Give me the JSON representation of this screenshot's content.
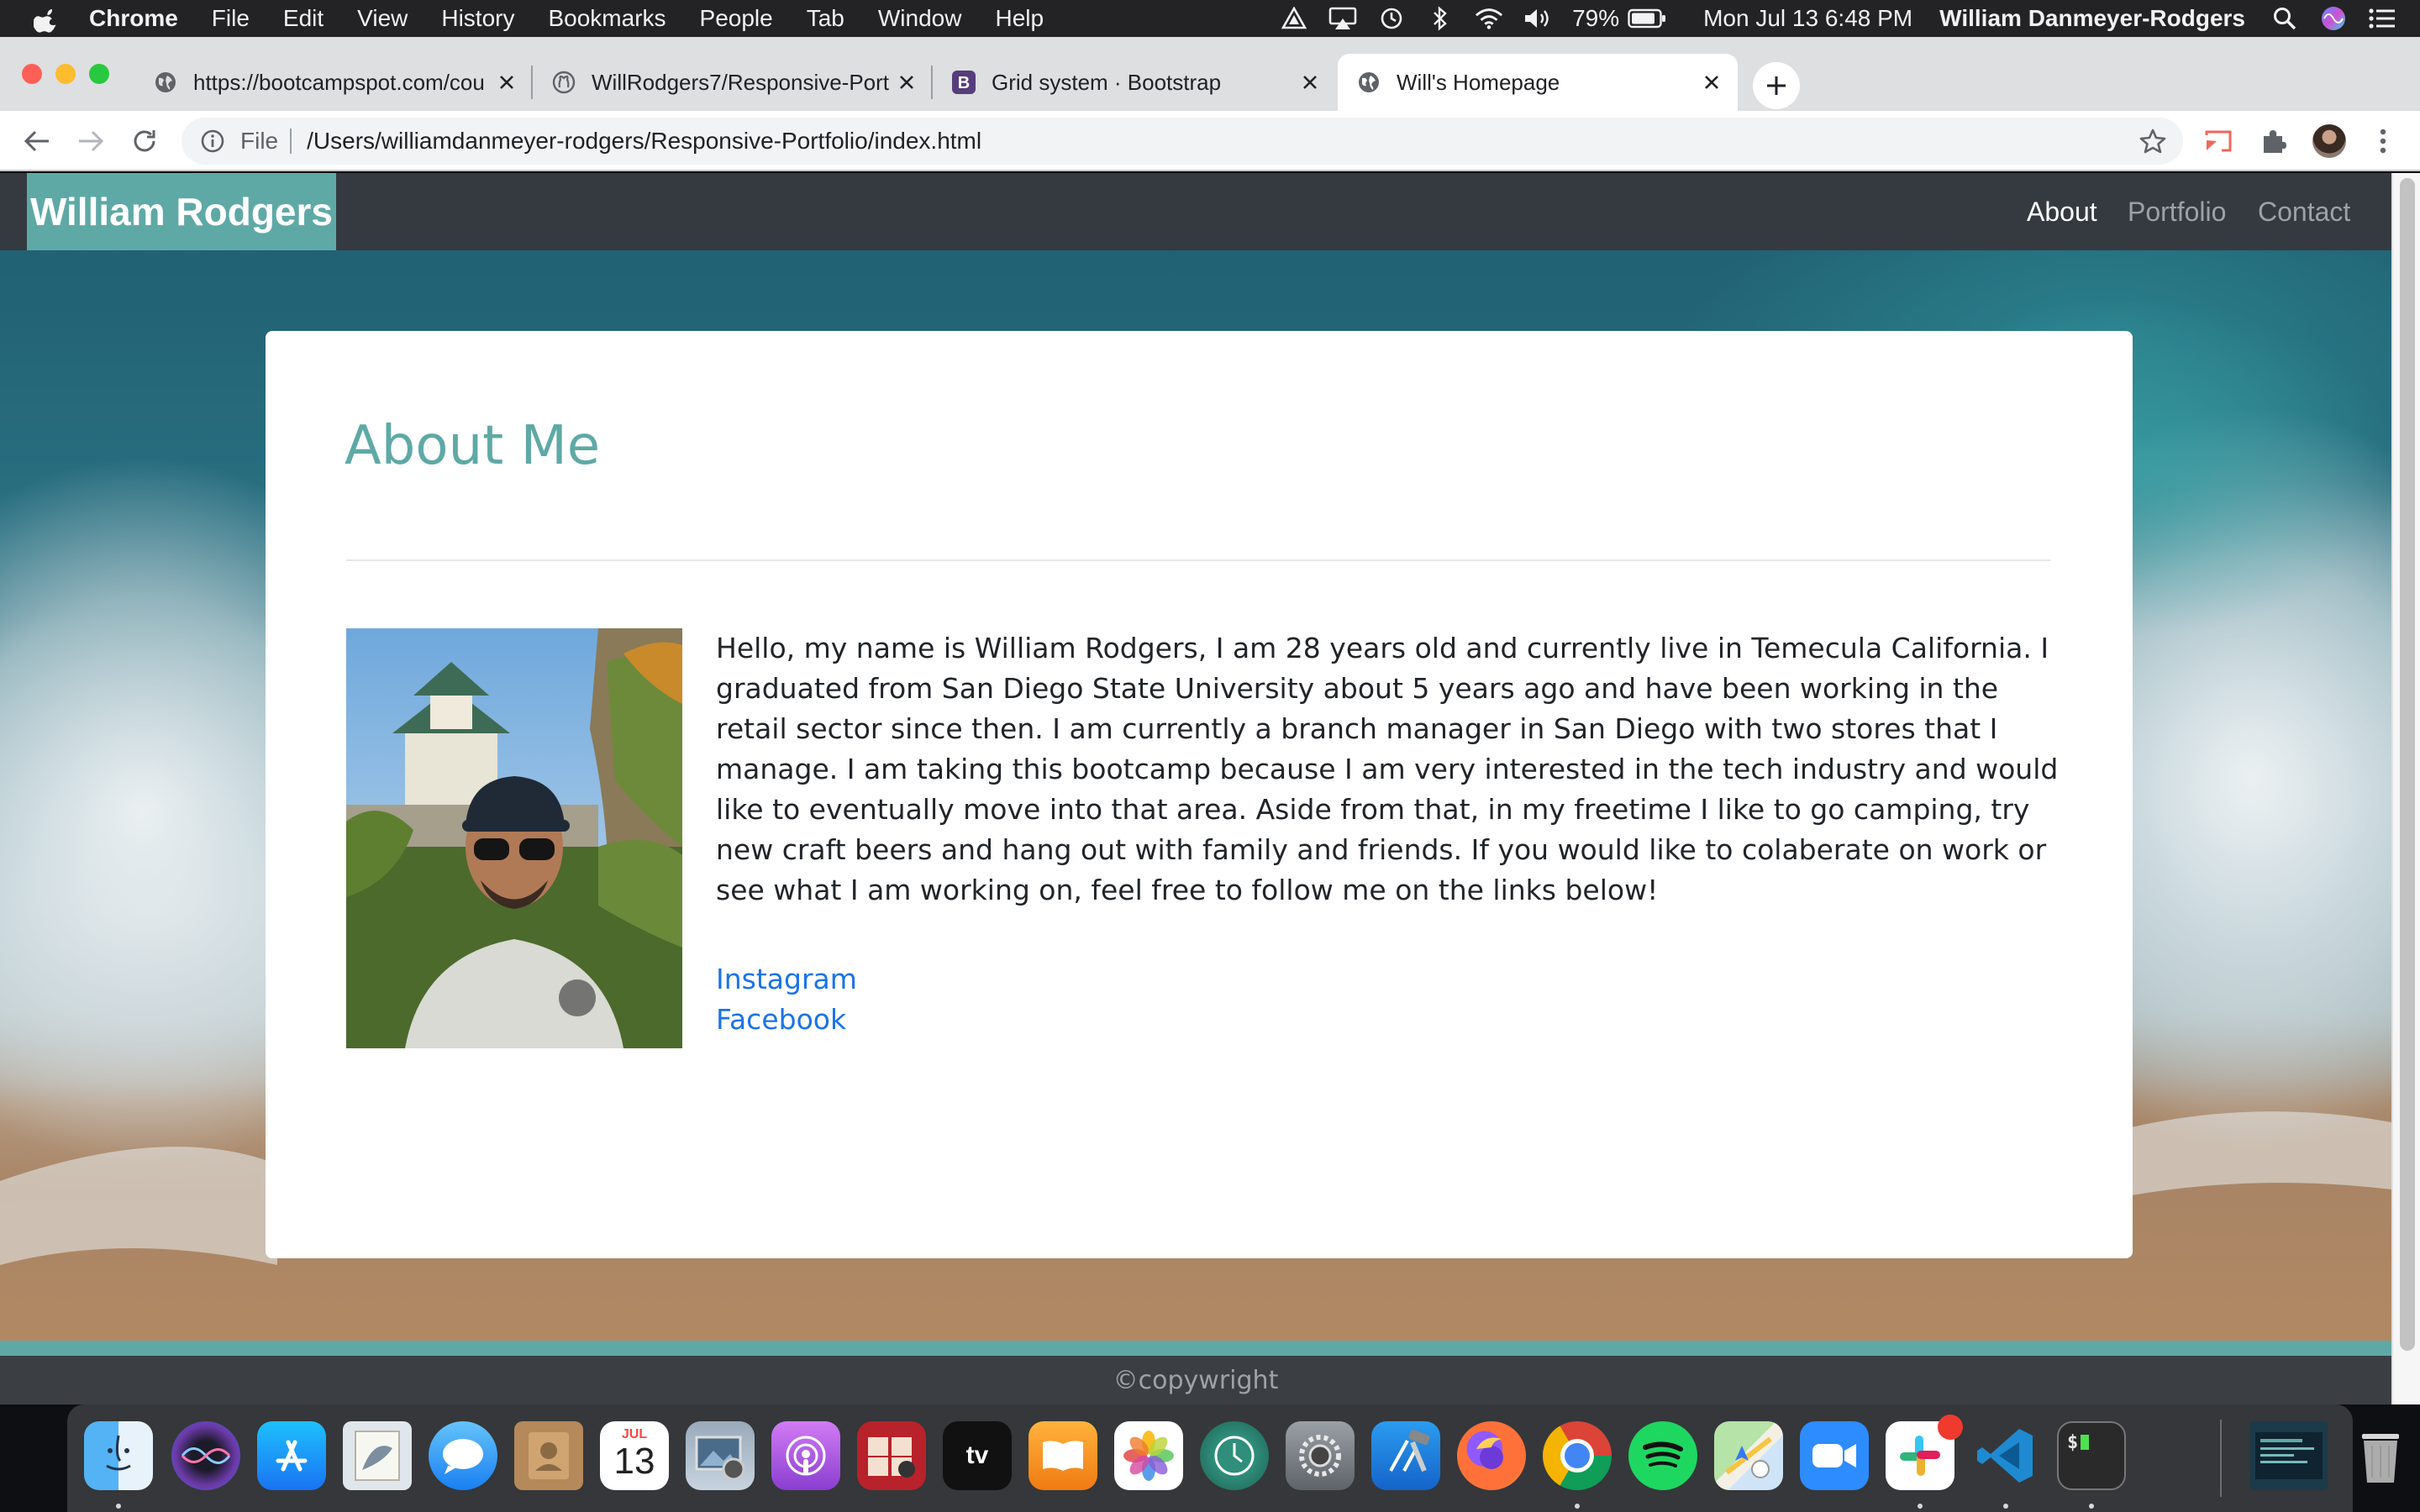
{
  "menubar": {
    "app": "Chrome",
    "items": [
      "File",
      "Edit",
      "View",
      "History",
      "Bookmarks",
      "People",
      "Tab",
      "Window",
      "Help"
    ],
    "battery": "79%",
    "datetime": "Mon Jul 13  6:48 PM",
    "user": "William Danmeyer-Rodgers"
  },
  "tabs": [
    {
      "title": "https://bootcampspot.com/cou",
      "favicon": "globe-icon"
    },
    {
      "title": "WillRodgers7/Responsive-Port",
      "favicon": "github-icon"
    },
    {
      "title": "Grid system · Bootstrap",
      "favicon": "bootstrap-icon"
    },
    {
      "title": "Will's Homepage",
      "favicon": "globe-icon"
    }
  ],
  "omnibox": {
    "scheme": "File",
    "url": "/Users/williamdanmeyer-rodgers/Responsive-Portfolio/index.html"
  },
  "site": {
    "brand": "William Rodgers",
    "nav": [
      "About",
      "Portfolio",
      "Contact"
    ],
    "heading": "About Me",
    "bio": "Hello, my name is William Rodgers, I am 28 years old and currently live in Temecula California. I graduated from San Diego State University about 5 years ago and have been working in the retail sector since then. I am currently a branch manager in San Diego with two stores that I manage. I am taking this bootcamp because I am very interested in the tech industry and would like to eventually move into that area. Aside from that, in my freetime I like to go camping, try new craft beers and hang out with family and friends. If you would like to colaberate on work or see what I am working on, feel free to follow me on the links below!",
    "links": [
      "Instagram",
      "Facebook"
    ],
    "footer": "©copywright"
  },
  "colors": {
    "accent": "#5ea9a6",
    "navbar": "#343a40",
    "link": "#1a73e8"
  },
  "dock": {
    "calendar_month": "JUL",
    "calendar_day": "13",
    "tv_label": "tv"
  }
}
